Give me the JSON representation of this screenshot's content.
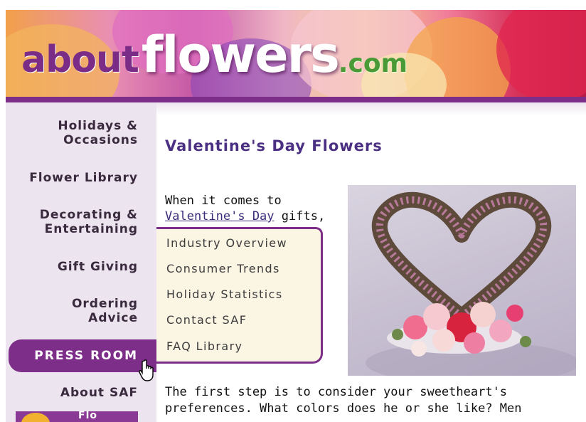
{
  "banner": {
    "logo_about": "about",
    "logo_flowers": "flowers",
    "logo_com": ".com",
    "accent_purple": "#7d2e88"
  },
  "sidebar": {
    "items": [
      {
        "label_line1": "Holidays &",
        "label_line2": "Occasions"
      },
      {
        "label_line1": "Flower Library"
      },
      {
        "label_line1": "Decorating &",
        "label_line2": "Entertaining"
      },
      {
        "label_line1": "Gift Giving"
      },
      {
        "label_line1": "Ordering",
        "label_line2": "Advice"
      }
    ],
    "press_room": "PRESS ROOM",
    "about_saf": "About SAF",
    "thumb_text": "Flo"
  },
  "main": {
    "title": "Valentine's Day Flowers",
    "intro_line1": "When it comes to",
    "intro_link": "Valentine's Day",
    "intro_after_link": " gifts,",
    "paragraph_lines": [
      "The first step is to consider your sweetheart's",
      "preferences. What colors does he or she like? Men"
    ],
    "photo_icon": "heart-floral-arrangement"
  },
  "dropdown": {
    "items": [
      "Industry Overview",
      "Consumer Trends",
      "Holiday Statistics",
      "Contact SAF",
      "FAQ Library"
    ]
  },
  "cursor": {
    "icon": "hand-pointer-icon"
  }
}
